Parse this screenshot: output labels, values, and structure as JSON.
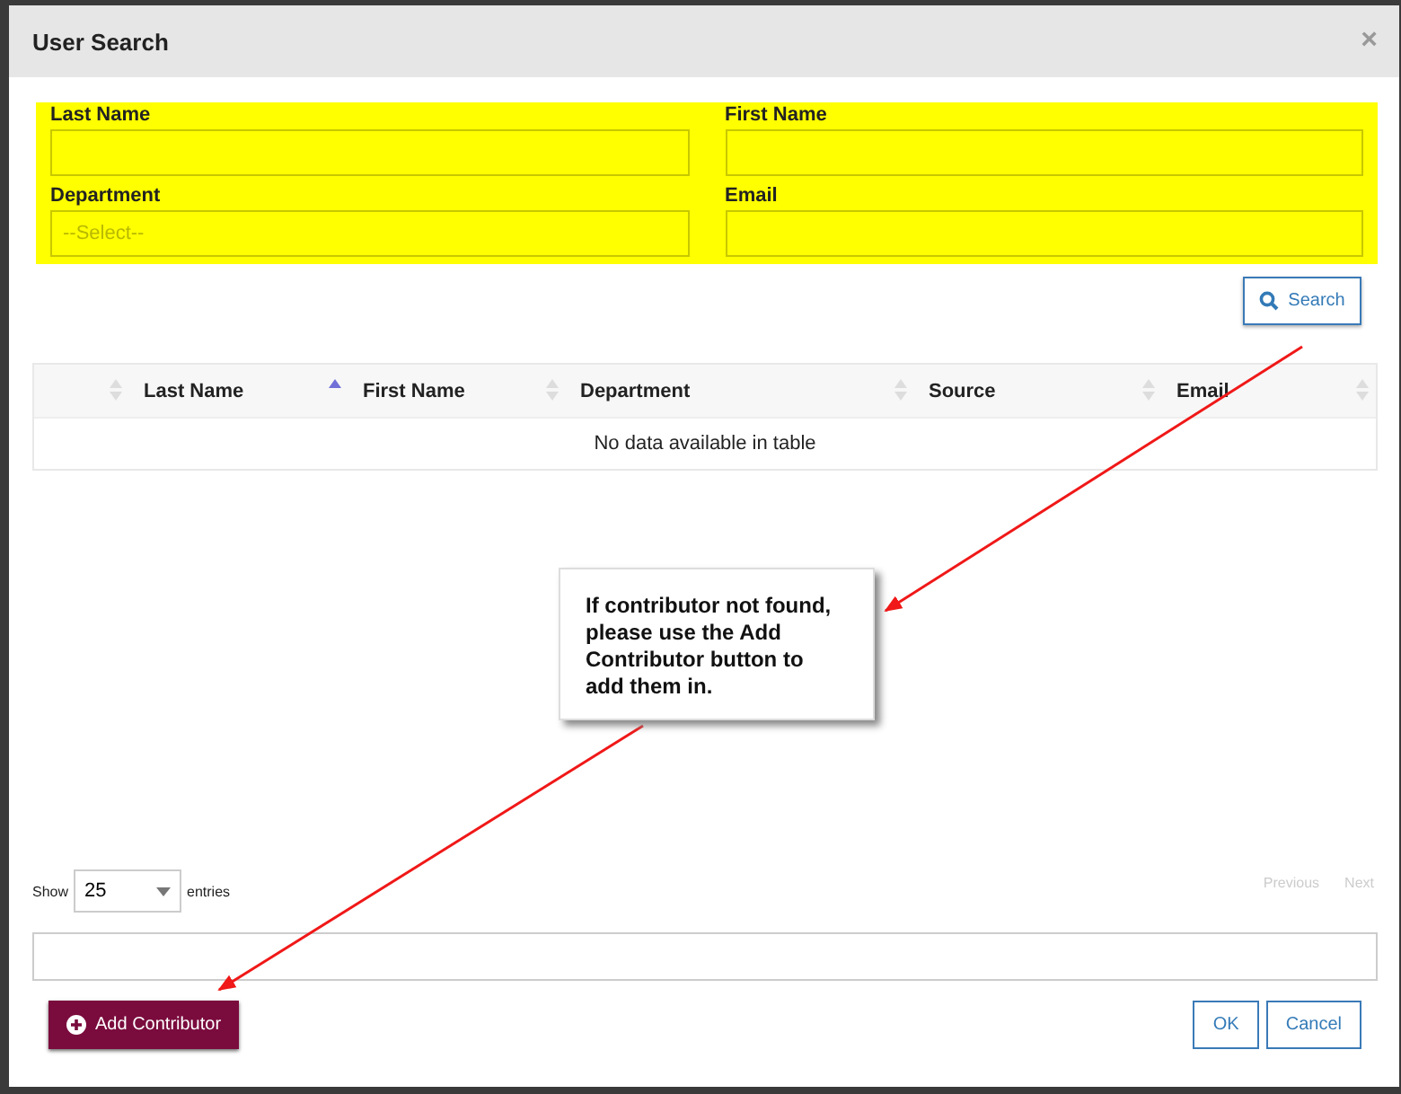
{
  "dialog": {
    "title": "User Search",
    "close": "×"
  },
  "fields": [
    {
      "label": "Last Name",
      "kind": "text"
    },
    {
      "label": "First Name",
      "kind": "text"
    },
    {
      "label": "Department",
      "kind": "select",
      "placeholder": "--Select--"
    },
    {
      "label": "Email",
      "kind": "text"
    }
  ],
  "search_button": "Search",
  "table": {
    "columns": [
      {
        "sorted": false
      },
      {
        "label": "Last Name",
        "sorted": true
      },
      {
        "label": "First Name",
        "sorted": false
      },
      {
        "label": "Department",
        "sorted": false
      },
      {
        "label": "Source",
        "sorted": false
      },
      {
        "label": "Email",
        "sorted": false
      }
    ],
    "empty_message": "No data available in table"
  },
  "page_length": {
    "before": "Show",
    "value": "25",
    "after": "entries"
  },
  "pagination": [
    {
      "label": "Previous",
      "disabled": true
    },
    {
      "label": "Next",
      "disabled": true
    }
  ],
  "add_button": "Add Contributor",
  "buttons": [
    "OK",
    "Cancel"
  ],
  "callout": "If contributor not found, please use the Add Contributor button to add them in."
}
